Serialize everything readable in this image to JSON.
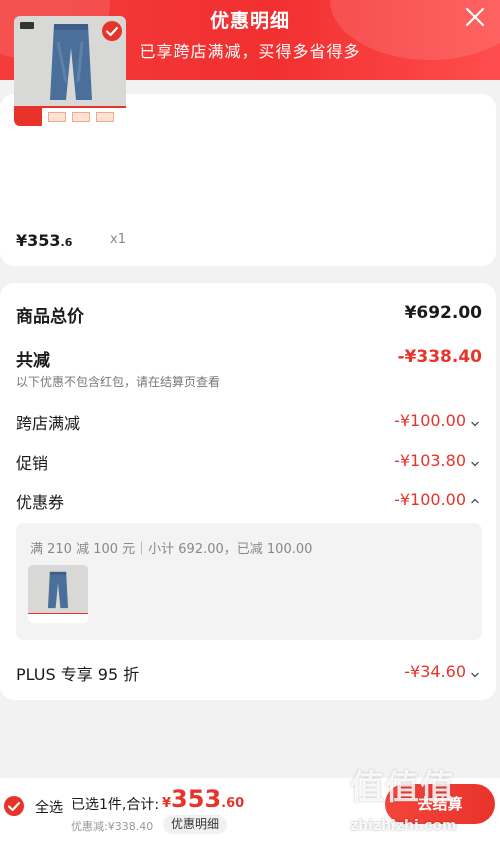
{
  "header": {
    "title": "优惠明细",
    "subtitle": "已享跨店满减，买得多省得多",
    "close_icon": "close-icon"
  },
  "product": {
    "price_int": "¥353",
    "price_dec": ".6",
    "quantity": "x1",
    "selected": true
  },
  "summary": {
    "total_label": "商品总价",
    "total_value": "¥692.00",
    "reduce_label": "共减",
    "reduce_value": "-¥338.40",
    "note": "以下优惠不包含红包，请在结算页查看",
    "rows": [
      {
        "label": "跨店满减",
        "value": "-¥100.00",
        "chevron": "chevron-down-icon"
      },
      {
        "label": "促销",
        "value": "-¥103.80",
        "chevron": "chevron-down-icon"
      },
      {
        "label": "优惠券",
        "value": "-¥100.00",
        "chevron": "chevron-up-icon"
      }
    ],
    "coupon_detail": "满 210 减 100 元｜小计 692.00，已减 100.00",
    "plus_label": "PLUS 专享 95 折",
    "plus_value": "-¥34.60"
  },
  "bottom_bar": {
    "select_all": "全选",
    "selected_summary": "已选1件,合计:",
    "total_currency": "¥",
    "total_int": "353",
    "total_dec": ".60",
    "discount": "优惠减:¥338.40",
    "detail_button": "优惠明细",
    "checkout_button": "去结算"
  },
  "watermark": {
    "logo": "值值值",
    "url": "zhizhizhi.com"
  },
  "colors": {
    "accent": "#e8332b",
    "header_bg": "#f23030",
    "page_bg": "#f2f2f2"
  }
}
